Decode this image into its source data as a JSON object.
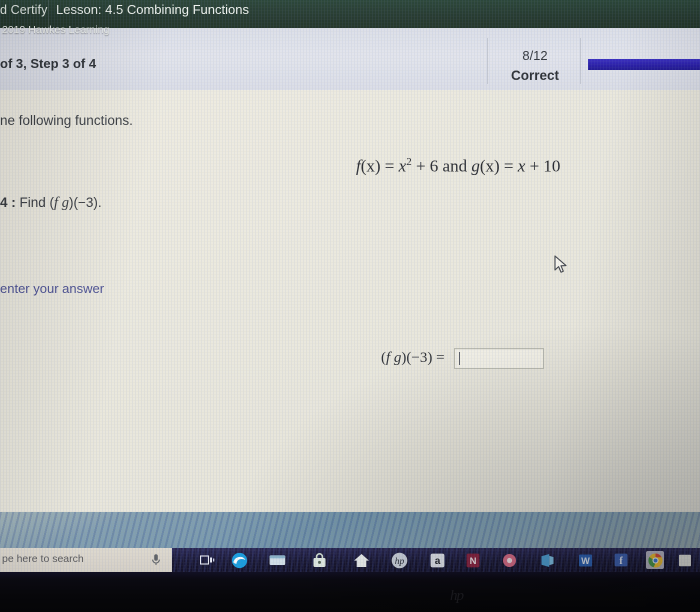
{
  "header": {
    "brand_tail": "d Certify",
    "lesson_title": "Lesson: 4.5 Combining Functions",
    "background_color": "#274034"
  },
  "status_bar": {
    "step_label": "of 3, Step 3 of 4",
    "score_fraction": "8/12",
    "score_word": "Correct",
    "progress_percent": 100,
    "progress_color": "#2a20ac"
  },
  "exercise": {
    "instruction": "ne following functions.",
    "equation": {
      "f_name": "f",
      "f_arg": "(x) = ",
      "f_base": "x",
      "f_exponent": "2",
      "f_tail": " + 6 ",
      "conjunction": "and ",
      "g_name": "g",
      "g_body": "(x) = ",
      "g_var": "x",
      "g_tail": " + 10",
      "plain": "f(x) = x2 + 6 and g(x) = x + 10"
    },
    "question_number": "4 :",
    "question_prefix": "Find (",
    "question_fg": "f g",
    "question_suffix": ")(−3).",
    "answer_hint": "enter your answer",
    "answer_expression_open": "(",
    "answer_expression_fg": "f g",
    "answer_expression_close": ")(−3) =",
    "answer_value": "",
    "answer_placeholder": ""
  },
  "footer": {
    "copyright": "2019 Hawkes Learning"
  },
  "taskbar": {
    "search_placeholder": "pe here to search",
    "icons": [
      {
        "name": "microphone-icon",
        "glyph": "Ἲ4"
      },
      {
        "name": "task-view-icon",
        "glyph": "⌸"
      },
      {
        "name": "edge-browser-icon",
        "glyph": "e"
      },
      {
        "name": "file-explorer-icon",
        "glyph": "▭"
      },
      {
        "name": "microsoft-store-icon",
        "glyph": "ὬD"
      },
      {
        "name": "home-icon",
        "glyph": "⌂"
      },
      {
        "name": "hp-app-icon",
        "glyph": "hp"
      },
      {
        "name": "amazon-icon",
        "glyph": "a"
      },
      {
        "name": "netflix-icon",
        "glyph": "N"
      },
      {
        "name": "media-icon",
        "glyph": "◉"
      },
      {
        "name": "office-icon",
        "glyph": "■"
      },
      {
        "name": "word-icon",
        "glyph": "W"
      },
      {
        "name": "facebook-icon",
        "glyph": "f"
      },
      {
        "name": "chrome-browser-icon",
        "glyph": "●"
      },
      {
        "name": "document-window-icon",
        "glyph": "▮"
      },
      {
        "name": "folder-window-icon",
        "glyph": "▬"
      },
      {
        "name": "checkmark-icon",
        "glyph": "✓"
      }
    ]
  },
  "device": {
    "logo": "hp"
  }
}
